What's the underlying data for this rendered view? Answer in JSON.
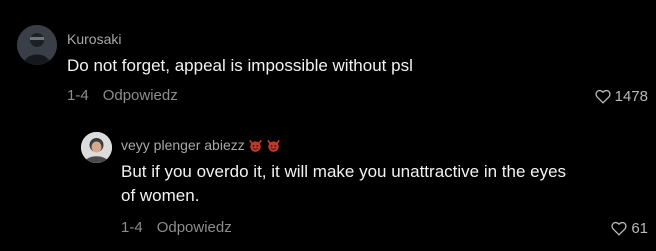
{
  "comments": [
    {
      "username": "Kurosaki",
      "text": "Do not forget, appeal is impossible without psl",
      "date": "1-4",
      "reply_label": "Odpowiedz",
      "likes": "1478"
    }
  ],
  "replies": [
    {
      "username": "veyy plenger abiezz",
      "emoji_icons": [
        "smiling-imp-icon",
        "smiling-imp-icon"
      ],
      "text": "But if you overdo it, it will make you unattractive in the eyes of women.",
      "date": "1-4",
      "reply_label": "Odpowiedz",
      "likes": "61"
    }
  ],
  "colors": {
    "background": "#000000",
    "username": "#a8a8ab",
    "meta": "#8d8d90",
    "emoji": "#c0392b"
  }
}
